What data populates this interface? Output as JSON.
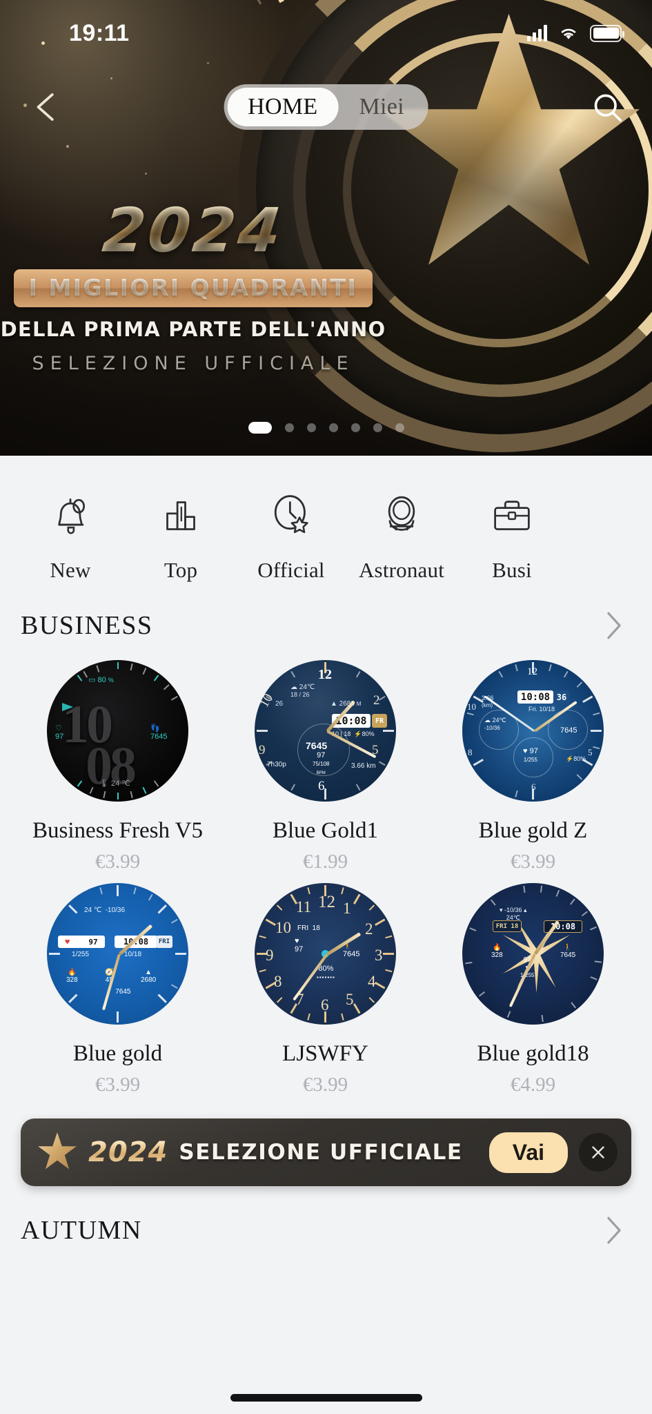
{
  "status_bar": {
    "time": "19:11",
    "signal_icon": "cellular-signal-icon",
    "wifi_icon": "wifi-icon",
    "battery_icon": "battery-icon"
  },
  "hero": {
    "back_icon": "back-arrow-icon",
    "search_icon": "search-icon",
    "tabs": [
      {
        "label": "HOME",
        "active": true
      },
      {
        "label": "Miei",
        "active": false
      }
    ],
    "year": "2024",
    "badge": "I MIGLIORI QUADRANTI",
    "subtitle": "DELLA PRIMA PARTE DELL'ANNO",
    "tagline": "SELEZIONE UFFICIALE",
    "pagination": {
      "total": 7,
      "active_index": 0
    }
  },
  "categories": [
    {
      "label": "New",
      "icon": "bell-icon"
    },
    {
      "label": "Top",
      "icon": "bar-chart-icon"
    },
    {
      "label": "Official",
      "icon": "clock-star-icon"
    },
    {
      "label": "Astronaut",
      "icon": "astronaut-icon"
    },
    {
      "label": "Busi",
      "icon": "briefcase-icon"
    }
  ],
  "sections": [
    {
      "title": "BUSINESS",
      "chevron_icon": "chevron-right-icon",
      "items": [
        {
          "name": "Business Fresh V5",
          "price": "€3.99",
          "face": "black"
        },
        {
          "name": "Blue Gold1",
          "price": "€1.99",
          "face": "navy-chrono"
        },
        {
          "name": "Blue gold Z",
          "price": "€3.99",
          "face": "blue-multi"
        },
        {
          "name": "Blue gold",
          "price": "€3.99",
          "face": "bright-blue"
        },
        {
          "name": "LJSWFY",
          "price": "€3.99",
          "face": "dark-navy"
        },
        {
          "name": "Blue gold18",
          "price": "€4.99",
          "face": "deep-navy"
        }
      ]
    }
  ],
  "promo": {
    "star_icon": "star-icon",
    "year": "2024",
    "text": "SELEZIONE UFFICIALE",
    "cta": "Vai",
    "close_icon": "close-icon"
  },
  "footer_section": {
    "title": "AUTUMN",
    "chevron_icon": "chevron-right-icon"
  },
  "watch_face_details": {
    "business_fresh_v5": {
      "battery": "80",
      "heart_rate": "97",
      "steps": "7645",
      "temp": "24",
      "time": "10 08"
    },
    "blue_gold1": {
      "top_num": "12",
      "temp": "24℃",
      "range": "18 / 26",
      "date_small": "26",
      "altitude": "2680",
      "alt_unit": "M",
      "time": "10:08",
      "day": "FR",
      "date_row": "10  18",
      "battery": "80%",
      "steps": "7645",
      "hr": "97",
      "hr_range": "75/108",
      "bpm_label": "BPM",
      "pace": "7h30p",
      "distance": "3.66 km",
      "left_num": "10",
      "right_num": "2",
      "b_left": "9",
      "b_right": "6"
    },
    "blue_gold_z": {
      "time": "10:08",
      "seconds": "36",
      "distance": "3.66",
      "dist_unit": "(km)",
      "day_date": "Fri.  10/18",
      "temp": "24℃",
      "temp_range": "-10/36",
      "hr": "97",
      "hr_range": "1/255",
      "steps": "7645",
      "battery": "80%",
      "top_num": "12"
    },
    "blue_gold": {
      "temp": "24 ℃",
      "temp_range": "-10/36",
      "hr": "97",
      "time": "10:08",
      "day": "FRI",
      "hr_range": "1/255",
      "date": "10/18",
      "calories": "328",
      "minutes": "45",
      "altitude": "2680",
      "steps": "7645"
    },
    "ljswfy": {
      "hr": "97",
      "steps": "7645",
      "battery": "80%",
      "numbers": [
        "12",
        "1",
        "2",
        "3",
        "4",
        "5",
        "6",
        "7",
        "8",
        "9",
        "10",
        "11"
      ]
    },
    "blue_gold18": {
      "temp": "24℃",
      "temp_range": "-10/36",
      "day": "FRI",
      "date": "18",
      "time": "10:08",
      "calories": "328",
      "hr": "97",
      "hr_range": "1-255",
      "steps": "7645"
    }
  }
}
